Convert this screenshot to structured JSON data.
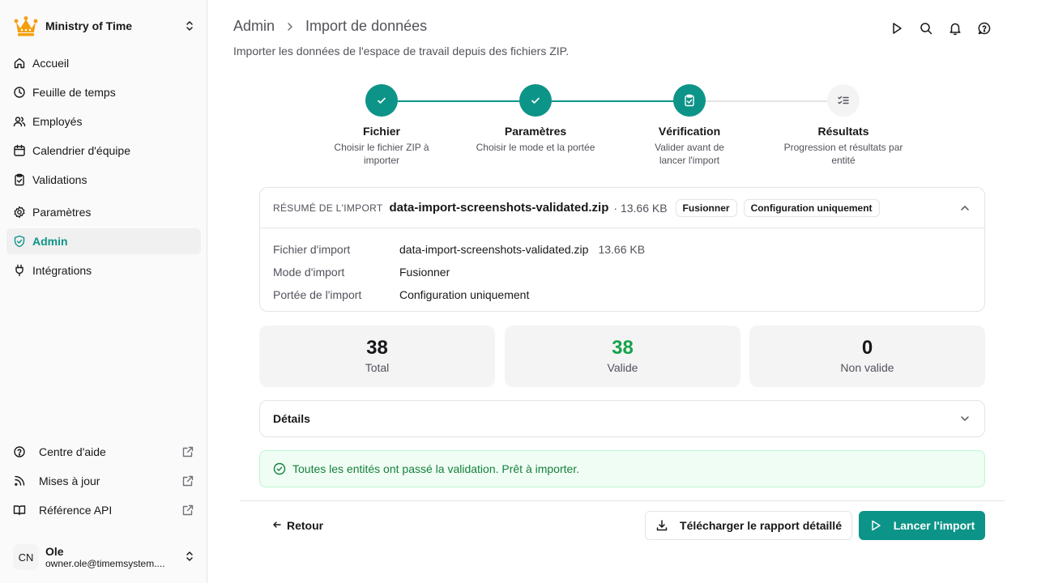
{
  "org": {
    "name": "Ministry of Time",
    "icon": "crown-icon"
  },
  "nav": [
    {
      "label": "Accueil",
      "icon": "home-icon"
    },
    {
      "label": "Feuille de temps",
      "icon": "clock-icon"
    },
    {
      "label": "Employés",
      "icon": "users-icon"
    },
    {
      "label": "Calendrier d'équipe",
      "icon": "calendar-icon"
    },
    {
      "label": "Validations",
      "icon": "clipboard-check-icon"
    },
    {
      "label": "Paramètres",
      "icon": "gear-icon"
    },
    {
      "label": "Admin",
      "icon": "shield-check-icon",
      "active": true
    },
    {
      "label": "Intégrations",
      "icon": "plug-icon"
    }
  ],
  "links": [
    {
      "label": "Centre d'aide",
      "icon": "help-circle-icon"
    },
    {
      "label": "Mises à jour",
      "icon": "rss-icon"
    },
    {
      "label": "Référence API",
      "icon": "book-icon"
    }
  ],
  "user": {
    "initials": "CN",
    "name": "Ole",
    "email": "owner.ole@timemsystem...."
  },
  "breadcrumb": {
    "parent": "Admin",
    "current": "Import de données"
  },
  "subtitle": "Importer les données de l'espace de travail depuis des fichiers ZIP.",
  "steps": [
    {
      "title": "Fichier",
      "desc": "Choisir le fichier ZIP à importer",
      "state": "done"
    },
    {
      "title": "Paramètres",
      "desc": "Choisir le mode et la portée",
      "state": "done"
    },
    {
      "title": "Vérification",
      "desc": "Valider avant de lancer l'import",
      "state": "current"
    },
    {
      "title": "Résultats",
      "desc": "Progression et résultats par entité",
      "state": "todo"
    }
  ],
  "summary": {
    "kicker": "RÉSUMÉ DE L'IMPORT",
    "file_name": "data-import-screenshots-validated.zip",
    "file_size": "· 13.66 KB",
    "badge_mode": "Fusionner",
    "badge_scope": "Configuration uniquement",
    "rows": {
      "file_label": "Fichier d'import",
      "file_value": "data-import-screenshots-validated.zip",
      "file_size": "13.66 KB",
      "mode_label": "Mode d'import",
      "mode_value": "Fusionner",
      "scope_label": "Portée de l'import",
      "scope_value": "Configuration uniquement"
    }
  },
  "stats": {
    "total": {
      "value": "38",
      "label": "Total"
    },
    "valid": {
      "value": "38",
      "label": "Valide"
    },
    "invalid": {
      "value": "0",
      "label": "Non valide"
    }
  },
  "details_label": "Détails",
  "alert_text": "Toutes les entités ont passé la validation. Prêt à importer.",
  "footer": {
    "back_label": "Retour",
    "download_label": "Télécharger le rapport détaillé",
    "launch_label": "Lancer l'import"
  },
  "colors": {
    "accent": "#0d9488",
    "success": "#16a34a",
    "success_bg": "#f0fdf4"
  }
}
